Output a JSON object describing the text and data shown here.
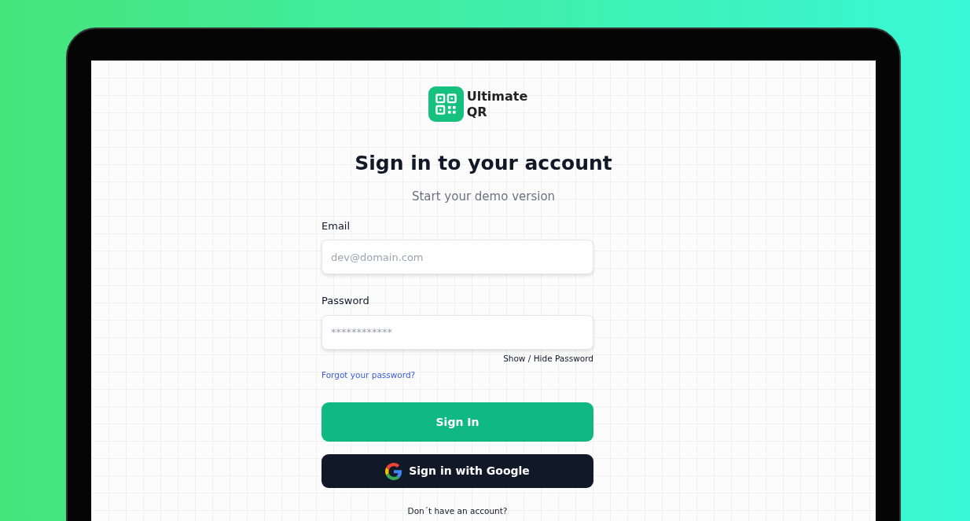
{
  "brand": {
    "name_line1": "Ultimate",
    "name_line2": "QR"
  },
  "heading": "Sign in to your account",
  "subtitle": "Start your demo version",
  "fields": [
    {
      "label": "Email",
      "placeholder": "dev@domain.com"
    },
    {
      "label": "Password",
      "placeholder": "************"
    }
  ],
  "show_hide": "Show / Hide Password",
  "forgot_link": "Forgot your password?",
  "sign_in_button": "Sign In",
  "google_button": "Sign in with Google",
  "signup_prompt": "Don´t have an account?"
}
